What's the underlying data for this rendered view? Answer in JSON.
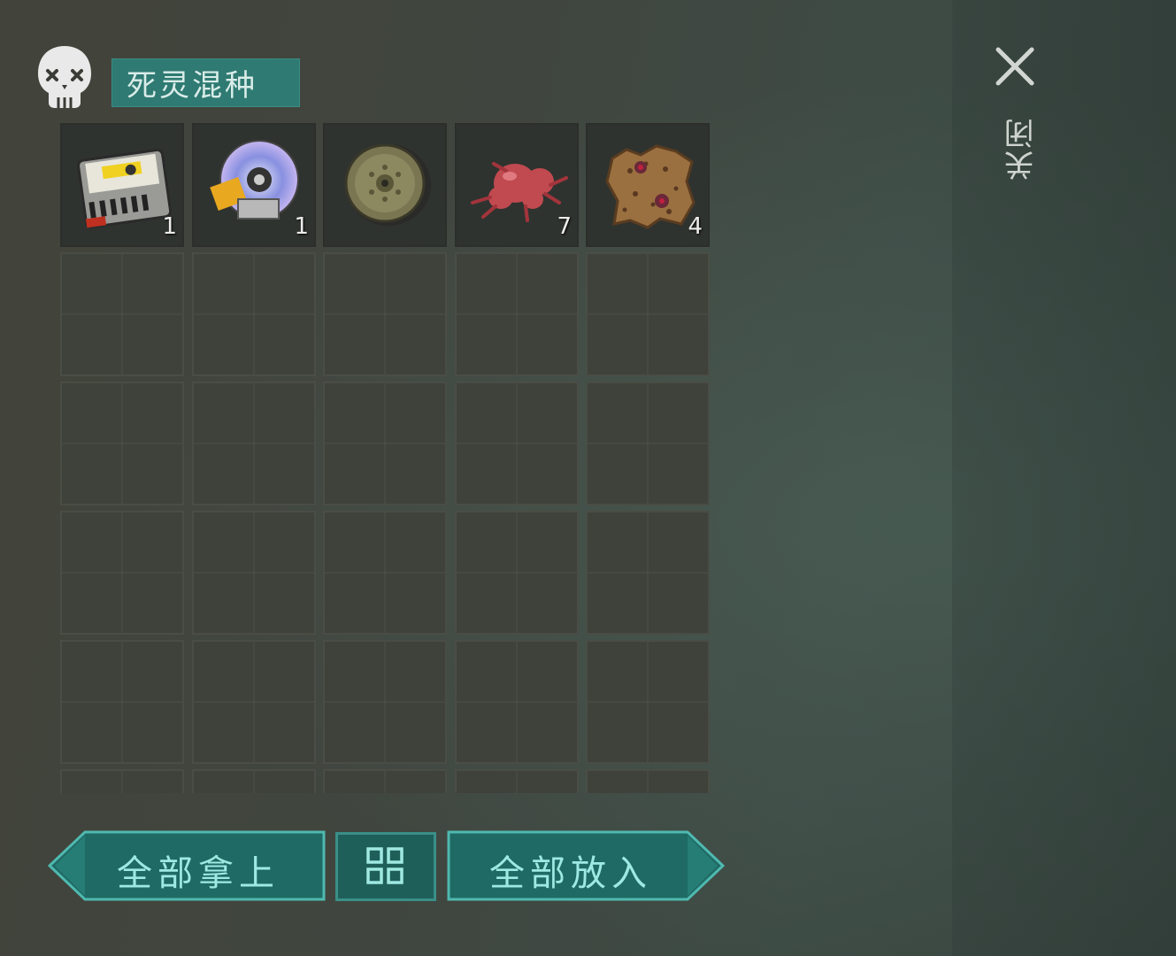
{
  "container": {
    "title": "死灵混种",
    "skull_icon": "skull-icon"
  },
  "close": {
    "label": "关闭",
    "icon": "close-icon"
  },
  "items": [
    {
      "name": "storage-drive",
      "icon": "data-drive-icon",
      "qty": "1"
    },
    {
      "name": "data-disc",
      "icon": "disc-icon",
      "qty": "1"
    },
    {
      "name": "metal-disc",
      "icon": "wheel-disc-icon",
      "qty": ""
    },
    {
      "name": "flesh-chunk",
      "icon": "organic-flesh-icon",
      "qty": "7"
    },
    {
      "name": "hide-pelt",
      "icon": "pelt-icon",
      "qty": "4"
    }
  ],
  "buttons": {
    "take_all": "全部拿上",
    "sort": "sort-icon",
    "put_all": "全部放入"
  },
  "colors": {
    "accent": "#2f7a73",
    "button_fill": "#1f6a64",
    "button_text": "#9fe9e2"
  }
}
